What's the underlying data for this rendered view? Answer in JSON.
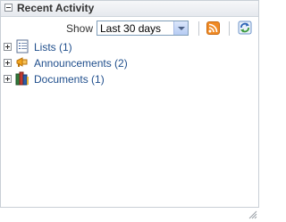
{
  "panel": {
    "title": "Recent Activity"
  },
  "toolbar": {
    "show_label": "Show",
    "period": "Last 30 days",
    "rss_icon": "rss-icon",
    "refresh_icon": "refresh-icon"
  },
  "items": [
    {
      "label": "Lists (1)",
      "icon": "list-icon"
    },
    {
      "label": "Announcements (2)",
      "icon": "megaphone-icon"
    },
    {
      "label": "Documents (1)",
      "icon": "books-icon"
    }
  ],
  "colors": {
    "link": "#1f4e8c",
    "rss": "#f08a24"
  }
}
